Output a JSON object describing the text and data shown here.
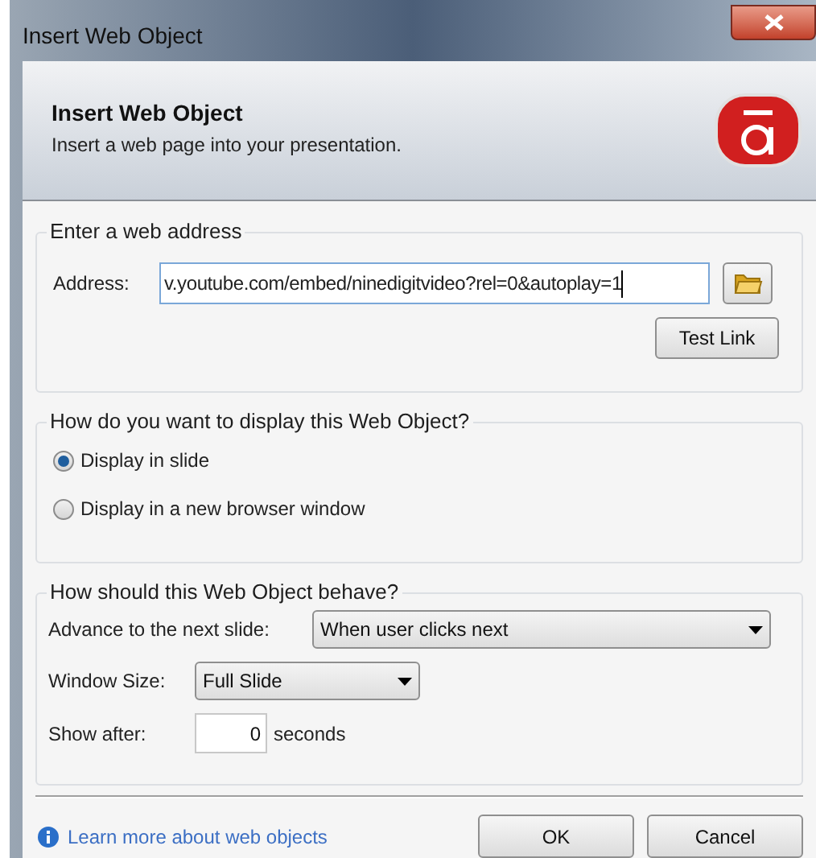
{
  "window": {
    "title": "Insert Web Object"
  },
  "header": {
    "title": "Insert Web Object",
    "subtitle": "Insert a web page into your presentation."
  },
  "address_group": {
    "legend": "Enter a web address",
    "label": "Address:",
    "value": "v.youtube.com/embed/ninedigitvideo?rel=0&autoplay=1",
    "test_button": "Test Link"
  },
  "display_group": {
    "legend": "How do you want to display this Web Object?",
    "options": [
      {
        "label": "Display in slide",
        "selected": true
      },
      {
        "label": "Display in a new browser window",
        "selected": false
      }
    ]
  },
  "behave_group": {
    "legend": "How should this Web Object behave?",
    "advance": {
      "label": "Advance to the next slide:",
      "value": "When user clicks next"
    },
    "window_size": {
      "label": "Window Size:",
      "value": "Full Slide"
    },
    "show_after": {
      "label": "Show after:",
      "value": "0",
      "unit": "seconds"
    }
  },
  "footer": {
    "link": "Learn more about web objects",
    "buttons": [
      "OK",
      "Cancel"
    ]
  }
}
